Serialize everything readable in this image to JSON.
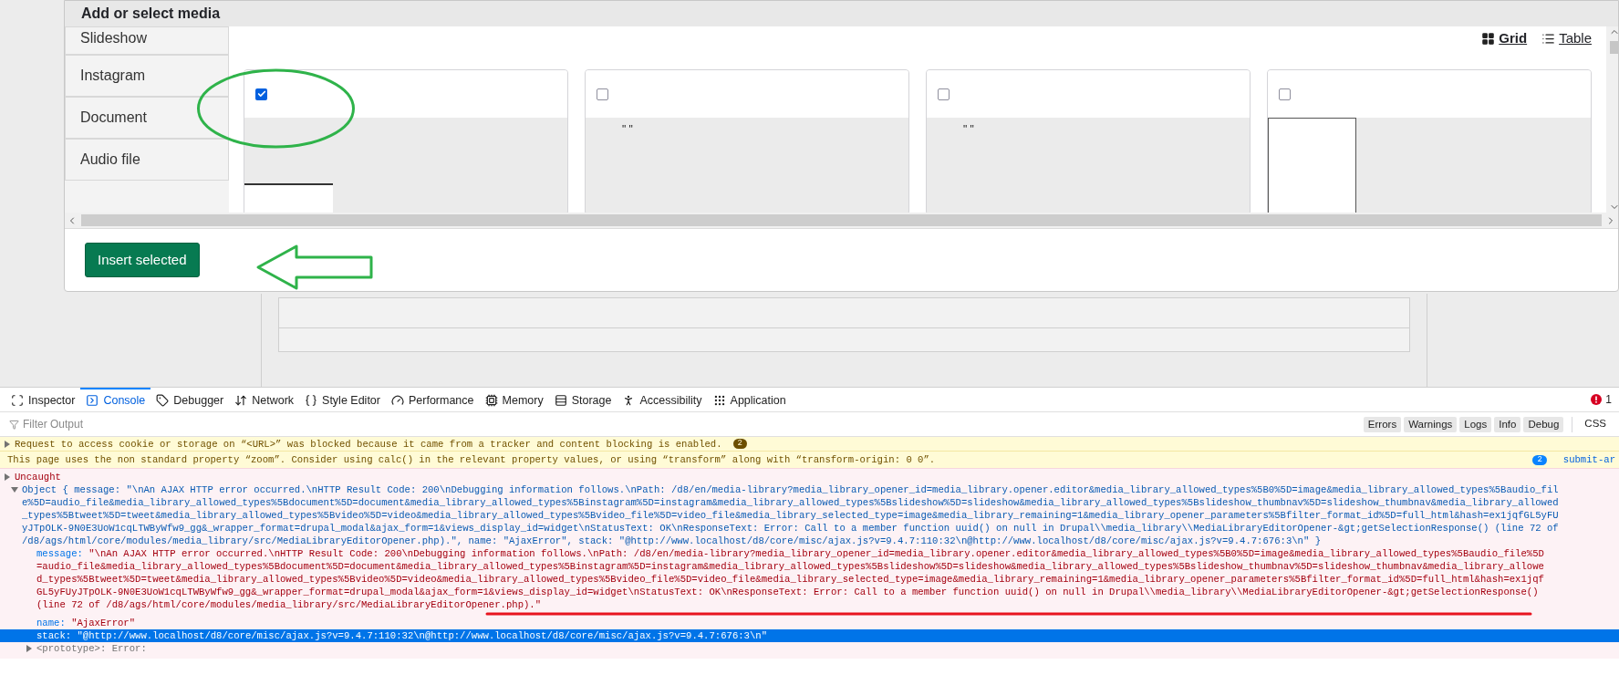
{
  "dialog": {
    "title": "Add or select media",
    "sidebar_tabs": [
      "Slideshow",
      "Instagram",
      "Document",
      "Audio file"
    ],
    "view_toggle": [
      {
        "label": "Grid",
        "selected": true
      },
      {
        "label": "Table",
        "selected": false
      }
    ],
    "media_cards": [
      {
        "kind": "thumbnail",
        "checked": true
      },
      {
        "kind": "quoted",
        "checked": false,
        "caption": "\" \""
      },
      {
        "kind": "quoted",
        "checked": false,
        "caption": "\" \""
      },
      {
        "kind": "frame",
        "checked": false
      }
    ],
    "insert_button": "Insert selected"
  },
  "devtools": {
    "tabs": [
      {
        "label": "Inspector",
        "selected": false
      },
      {
        "label": "Console",
        "selected": true
      },
      {
        "label": "Debugger",
        "selected": false
      },
      {
        "label": "Network",
        "selected": false
      },
      {
        "label": "Style Editor",
        "selected": false
      },
      {
        "label": "Performance",
        "selected": false
      },
      {
        "label": "Memory",
        "selected": false
      },
      {
        "label": "Storage",
        "selected": false
      },
      {
        "label": "Accessibility",
        "selected": false
      },
      {
        "label": "Application",
        "selected": false
      }
    ],
    "error_count": "1",
    "filter": {
      "placeholder": "Filter Output"
    },
    "filter_buttons": [
      "Errors",
      "Warnings",
      "Logs",
      "Info",
      "Debug"
    ],
    "css_label": "CSS",
    "messages": [
      {
        "kind": "warning",
        "expandable": true,
        "text": "Request to access cookie or storage on “<URL>” was blocked because it came from a tracker and content blocking is enabled.",
        "count": "2"
      },
      {
        "kind": "warning",
        "expandable": false,
        "text": "This page uses the non standard property “zoom”. Consider using calc() in the relevant property values, or using “transform” along with “transform-origin: 0 0”.",
        "count": "2",
        "source": "submit-ar"
      },
      {
        "kind": "error",
        "title": "Uncaught",
        "summary": "Object { message: \"\\nAn AJAX HTTP error occurred.\\nHTTP Result Code: 200\\nDebugging information follows.\\nPath: /d8/en/media-library?media_library_opener_id=media_library.opener.editor&media_library_allowed_types%5B0%5D=image&media_library_allowed_types%5Baudio_file%5D=audio_file&media_library_allowed_types%5Bdocument%5D=document&media_library_allowed_types%5Binstagram%5D=instagram&media_library_allowed_types%5Bslideshow%5D=slideshow&media_library_allowed_types%5Bslideshow_thumbnav%5D=slideshow_thumbnav&media_library_allowed_types%5Btweet%5D=tweet&media_library_allowed_types%5Bvideo%5D=video&media_library_allowed_types%5Bvideo_file%5D=video_file&media_library_selected_type=image&media_library_remaining=1&media_library_opener_parameters%5Bfilter_format_id%5D=full_html&hash=ex1jqfGL5yFUyJTpOLK-9N0E3UoW1cqLTWByWfw9_gg&_wrapper_format=drupal_modal&ajax_form=1&views_display_id=widget\\nStatusText: OK\\nResponseText: Error: Call to a member function uuid() on null in Drupal\\\\media_library\\\\MediaLibraryEditorOpener-&gt;getSelectionResponse() (line 72 of /d8/ags/html/core/modules/media_library/src/MediaLibraryEditorOpener.php).\", name: \"AjaxError\", stack: \"@http://www.localhost/d8/core/misc/ajax.js?v=9.4.7:110:32\\n@http://www.localhost/d8/core/misc/ajax.js?v=9.4.7:676:3\\n\" }",
        "properties": [
          {
            "key": "message:",
            "value": "\"\\nAn AJAX HTTP error occurred.\\nHTTP Result Code: 200\\nDebugging information follows.\\nPath: /d8/en/media-library?media_library_opener_id=media_library.opener.editor&media_library_allowed_types%5B0%5D=image&media_library_allowed_types%5Baudio_file%5D=audio_file&media_library_allowed_types%5Bdocument%5D=document&media_library_allowed_types%5Binstagram%5D=instagram&media_library_allowed_types%5Bslideshow%5D=slideshow&media_library_allowed_types%5Bslideshow_thumbnav%5D=slideshow_thumbnav&media_library_allowed_types%5Btweet%5D=tweet&media_library_allowed_types%5Bvideo%5D=video&media_library_allowed_types%5Bvideo_file%5D=video_file&media_library_selected_type=image&media_library_remaining=1&media_library_opener_parameters%5Bfilter_format_id%5D=full_html&hash=ex1jqfGL5yFUyJTpOLK-9N0E3UoW1cqLTWByWfw9_gg&_wrapper_format=drupal_modal&ajax_form=1&views_display_id=widget\\nStatusText: OK\\nResponseText: Error: Call to a member function uuid() on null in Drupal\\\\media_library\\\\MediaLibraryEditorOpener-&gt;getSelectionResponse() (line 72 of /d8/ags/html/core/modules/media_library/src/MediaLibraryEditorOpener.php).\"",
            "selected": false
          },
          {
            "key": "name:",
            "value": "\"AjaxError\"",
            "selected": false
          },
          {
            "key": "stack:",
            "value": "\"@http://www.localhost/d8/core/misc/ajax.js?v=9.4.7:110:32\\n@http://www.localhost/d8/core/misc/ajax.js?v=9.4.7:676:3\\n\"",
            "selected": true
          }
        ],
        "prototype": {
          "key": "<prototype>:",
          "value": "Error:"
        }
      }
    ]
  }
}
